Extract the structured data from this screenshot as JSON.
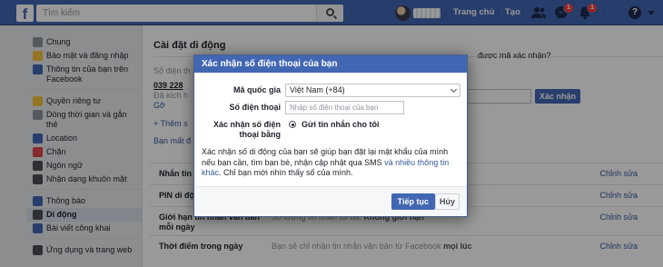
{
  "topbar": {
    "logo": "f",
    "search_placeholder": "Tìm kiếm",
    "nav_home": "Trang chủ",
    "nav_create": "Tạo",
    "friend_badge": "",
    "messages_badge": "1",
    "notif_badge": "1",
    "help": "?"
  },
  "sidebar": {
    "group1": [
      {
        "label": "Chung",
        "icon": "gear-icon",
        "color": "#8d949e"
      },
      {
        "label": "Bảo mật và đăng nhập",
        "icon": "shield-icon",
        "color": "#f5c33b"
      },
      {
        "label": "Thông tin của bạn trên Facebook",
        "icon": "facebook-icon",
        "color": "#4267b2"
      }
    ],
    "group2": [
      {
        "label": "Quyền riêng tư",
        "icon": "lock-icon",
        "color": "#f5c33b"
      },
      {
        "label": "Dòng thời gian và gắn thẻ",
        "icon": "timeline-icon",
        "color": "#8d949e"
      },
      {
        "label": "Location",
        "icon": "location-icon",
        "color": "#4267b2"
      },
      {
        "label": "Chặn",
        "icon": "block-icon",
        "color": "#e0434a"
      },
      {
        "label": "Ngôn ngữ",
        "icon": "language-icon",
        "color": "#4b4f56"
      },
      {
        "label": "Nhận dạng khuôn mặt",
        "icon": "face-icon",
        "color": "#4b4f56"
      }
    ],
    "group3": [
      {
        "label": "Thông báo",
        "icon": "globe-icon",
        "color": "#4267b2"
      },
      {
        "label": "Di động",
        "icon": "mobile-icon",
        "color": "#4b4f56",
        "active": true
      },
      {
        "label": "Bài viết công khai",
        "icon": "rss-icon",
        "color": "#4267b2"
      }
    ],
    "group4": [
      {
        "label": "Ứng dụng và trang web",
        "icon": "apps-icon",
        "color": "#4b4f56"
      }
    ]
  },
  "content": {
    "title": "Cài đặt di động",
    "phone_label": "Số điện th",
    "phone_number": "039 228",
    "phone_status": "Đã kích h",
    "phone_remove": "Gỡ",
    "add_more": "+ Thêm s",
    "lost_phone": "Bạn mất đ",
    "rows": [
      {
        "label": "Nhắn tin văn",
        "value": "",
        "edit": "Chỉnh sửa"
      },
      {
        "label": "PIN di động",
        "value": "",
        "edit": "Chỉnh sửa"
      },
      {
        "label": "Giới hạn tin nhắn văn bản mỗi ngày",
        "value": "Số lượng tin nhắn tối đa:",
        "value_bold": "Không giới hạn",
        "edit": "Chỉnh sửa"
      },
      {
        "label": "Thời điểm trong ngày",
        "value": "Bạn sẽ chỉ nhận tin nhắn văn bản từ Facebook",
        "value_bold": "mọi lúc",
        "edit": "Chỉnh sửa"
      }
    ],
    "side_question": "được mã xác nhận?",
    "side_button": "Xác nhận"
  },
  "modal": {
    "title": "Xác nhận số điện thoại của bạn",
    "country_label": "Mã quốc gia",
    "country_value": "Việt Nam (+84)",
    "phone_label": "Số điện thoại",
    "phone_placeholder": "Nhập số điện thoại của bạn",
    "method_label": "Xác nhận số điện thoại bằng",
    "method_option": "Gửi tin nhắn cho tôi",
    "desc_before": "Xác nhận số di động của bạn sẽ giúp bạn đặt lại mật khẩu của mình nếu bạn cần, tìm bạn bè, nhận cập nhật qua SMS ",
    "desc_link": "và nhiều thông tin khác",
    "desc_after": ". Chỉ bạn mới nhìn thấy số của mình.",
    "continue": "Tiếp tục",
    "cancel": "Hủy"
  }
}
